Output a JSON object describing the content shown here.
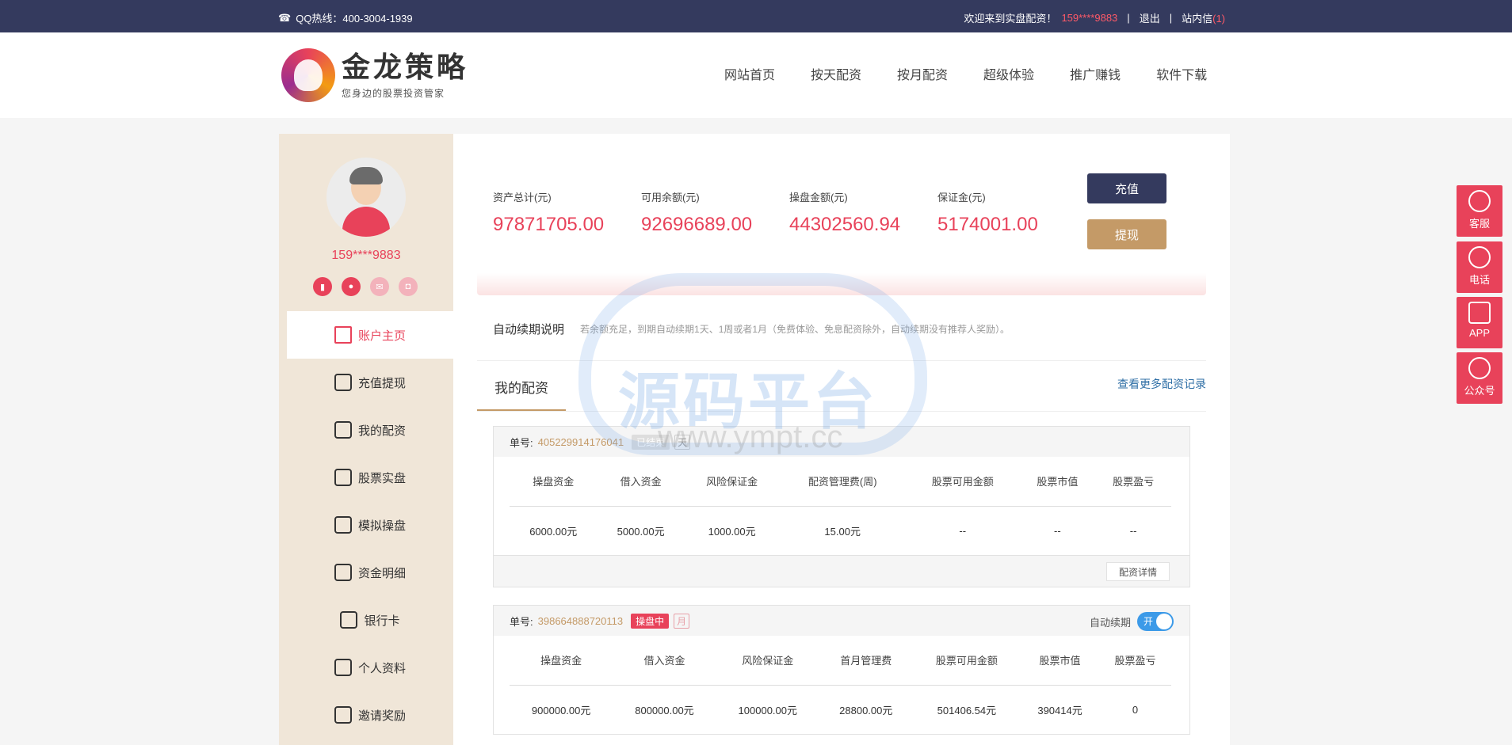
{
  "topbar": {
    "hotline": "QQ热线：400-3004-1939",
    "welcome": "欢迎来到实盘配资！",
    "user": "159****9883",
    "logout": "退出",
    "inbox": "站内信",
    "inbox_count": "(1)"
  },
  "logo": {
    "title": "金龙策略",
    "subtitle": "您身边的股票投资管家"
  },
  "nav": [
    "网站首页",
    "按天配资",
    "按月配资",
    "超级体验",
    "推广赚钱",
    "软件下载"
  ],
  "sidebar": {
    "phone": "159****9883",
    "menu": [
      "账户主页",
      "充值提现",
      "我的配资",
      "股票实盘",
      "模拟操盘",
      "资金明细",
      "银行卡",
      "个人资料",
      "邀请奖励"
    ]
  },
  "stats": [
    {
      "label": "资产总计(元)",
      "value": "97871705.00"
    },
    {
      "label": "可用余额(元)",
      "value": "92696689.00"
    },
    {
      "label": "操盘金额(元)",
      "value": "44302560.94"
    },
    {
      "label": "保证金(元)",
      "value": "5174001.00"
    }
  ],
  "buttons": {
    "recharge": "充值",
    "withdraw": "提现"
  },
  "renew": {
    "title": "自动续期说明",
    "desc": "若余额充足，到期自动续期1天、1周或者1月（免费体验、免息配资除外，自动续期没有推荐人奖励）。"
  },
  "section": {
    "title": "我的配资",
    "more": "查看更多配资记录"
  },
  "orders": [
    {
      "label": "单号:",
      "no": "405229914176041",
      "status": "已结束",
      "period": "天",
      "headers": [
        "操盘资金",
        "借入资金",
        "风险保证金",
        "配资管理费(周)",
        "股票可用金额",
        "股票市值",
        "股票盈亏"
      ],
      "values": [
        "6000.00元",
        "5000.00元",
        "1000.00元",
        "15.00元",
        "--",
        "--",
        "--"
      ],
      "detail": "配资详情"
    },
    {
      "label": "单号:",
      "no": "398664888720113",
      "status": "操盘中",
      "period": "月",
      "auto_label": "自动续期",
      "toggle": "开",
      "headers": [
        "操盘资金",
        "借入资金",
        "风险保证金",
        "首月管理费",
        "股票可用金额",
        "股票市值",
        "股票盈亏"
      ],
      "values": [
        "900000.00元",
        "800000.00元",
        "100000.00元",
        "28800.00元",
        "501406.54元",
        "390414元",
        "0"
      ]
    }
  ],
  "float": [
    "客服",
    "电话",
    "APP",
    "公众号"
  ],
  "watermark": {
    "main": "源码平台",
    "url": "www.ympt.cc"
  }
}
